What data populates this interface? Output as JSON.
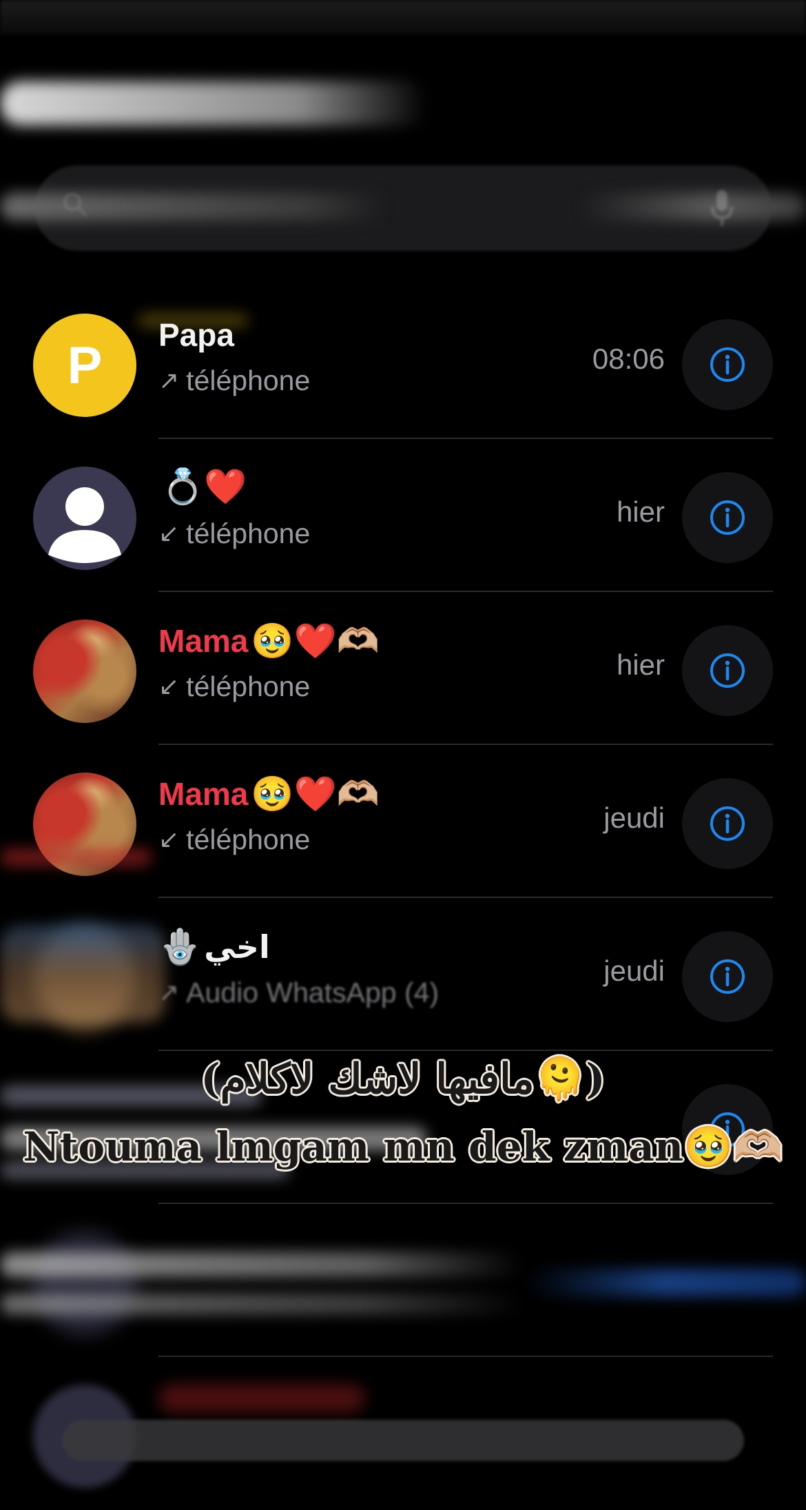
{
  "colors": {
    "background": "#000000",
    "accent_blue": "#1e88f0",
    "missed_red": "#f0394a",
    "secondary_text": "#9a9aa0",
    "avatar_yellow": "#f4c51d"
  },
  "calls": [
    {
      "name": "Papa",
      "name_emoji": "",
      "avatar_letter": "P",
      "direction_icon": "arrow-up-right-icon",
      "direction_glyph": "↗",
      "type": "téléphone",
      "time": "08:06"
    },
    {
      "name": "",
      "name_emoji": "💍❤️",
      "direction_icon": "arrow-down-left-icon",
      "direction_glyph": "↙",
      "type": "téléphone",
      "time": "hier"
    },
    {
      "name": "Mama",
      "name_emoji": "🥹❤️🫶🏼",
      "direction_icon": "arrow-down-left-icon",
      "direction_glyph": "↙",
      "type": "téléphone",
      "time": "hier"
    },
    {
      "name": "Mama",
      "name_emoji": "🥹❤️🫶🏼",
      "direction_icon": "arrow-down-left-icon",
      "direction_glyph": "↙",
      "type": "téléphone",
      "time": "jeudi"
    },
    {
      "name": "اخي",
      "name_emoji": "🪬",
      "direction_icon": "arrow-up-right-icon",
      "direction_glyph": "↗",
      "type": "Audio WhatsApp (4)",
      "time": "jeudi"
    }
  ],
  "overlay": {
    "line1": "(مافيها لاشك لاكلام🫠)",
    "line2": "Ntouma lmgam mn dek zman🥹🫶🏼"
  }
}
